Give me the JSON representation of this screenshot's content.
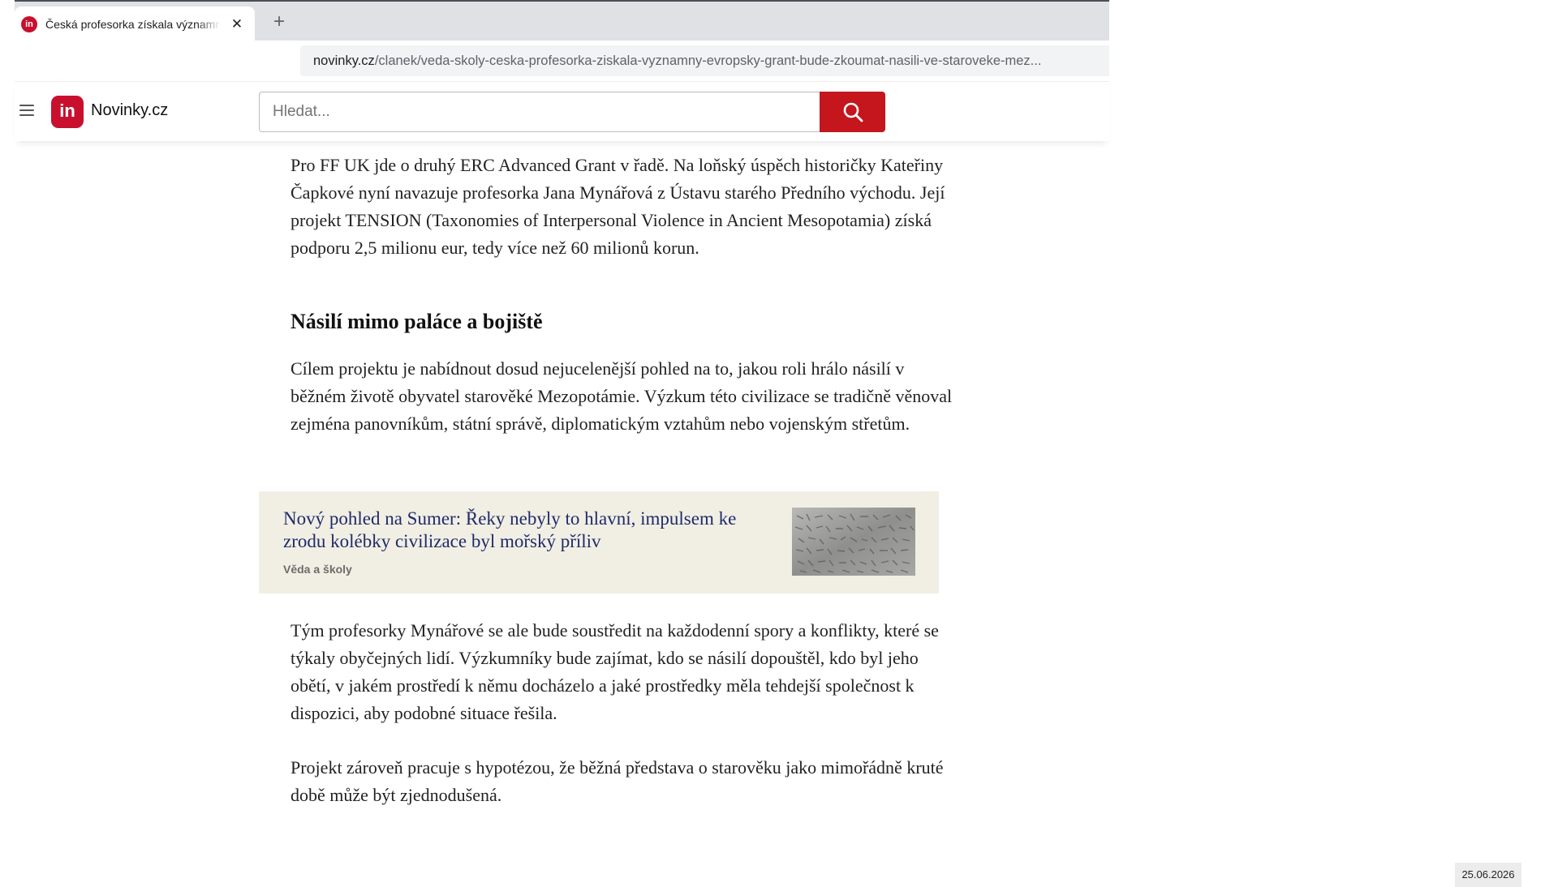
{
  "browser": {
    "tab_title": "Česká profesorka získala významný evropský grant",
    "favicon_text": "in",
    "url_domain": "novinky.cz",
    "url_path": "/clanek/veda-skoly-ceska-profesorka-ziskala-vyznamny-evropsky-grant-bude-zkoumat-nasili-ve-staroveke-mez..."
  },
  "header": {
    "logo_text": "in",
    "site_name": "Novinky.cz",
    "search_placeholder": "Hledat..."
  },
  "article": {
    "paragraph_1": "Pro FF UK jde o druhý ERC Advanced Grant v řadě. Na loňský úspěch historičky Kateřiny Čapkové nyní navazuje profesorka Jana Mynářová z Ústavu starého Předního východu. Její projekt TENSION (Taxonomies of Interpersonal Violence in Ancient Mesopotamia) získá podporu 2,5 milionu eur, tedy více než 60 milionů korun.",
    "heading": "Násilí mimo paláce a bojiště",
    "paragraph_2": "Cílem projektu je nabídnout dosud nejucelenější pohled na to, jakou roli hrálo násilí v běžném životě obyvatel starověké Mezopotámie. Výzkum této civilizace se tradičně věnoval zejména panovníkům, státní správě, diplomatickým vztahům nebo vojenským střetům.",
    "related": {
      "title": "Nový pohled na Sumer: Řeky nebyly to hlavní, impulsem ke zrodu kolébky civilizace byl mořský příliv",
      "category": "Věda a školy"
    },
    "paragraph_3": "Tým profesorky Mynářové se ale bude soustředit na každodenní spory a konflikty, které se týkaly obyčejných lidí. Výzkumníky bude zajímat, kdo se násilí dopouštěl, kdo byl jeho obětí, v jakém prostředí k němu docházelo a jaké prostředky měla tehdejší společnost k dispozici, aby podobné situace řešila.",
    "paragraph_4": "Projekt zároveň pracuje s hypotézou, že běžná představa o starověku jako mimořádně kruté době může být zjednodušená."
  },
  "footer": {
    "date": "25.06.2026"
  },
  "colors": {
    "brand_red": "#c4161c",
    "related_bg": "#f1efe3",
    "related_title": "#1f2a6b"
  }
}
